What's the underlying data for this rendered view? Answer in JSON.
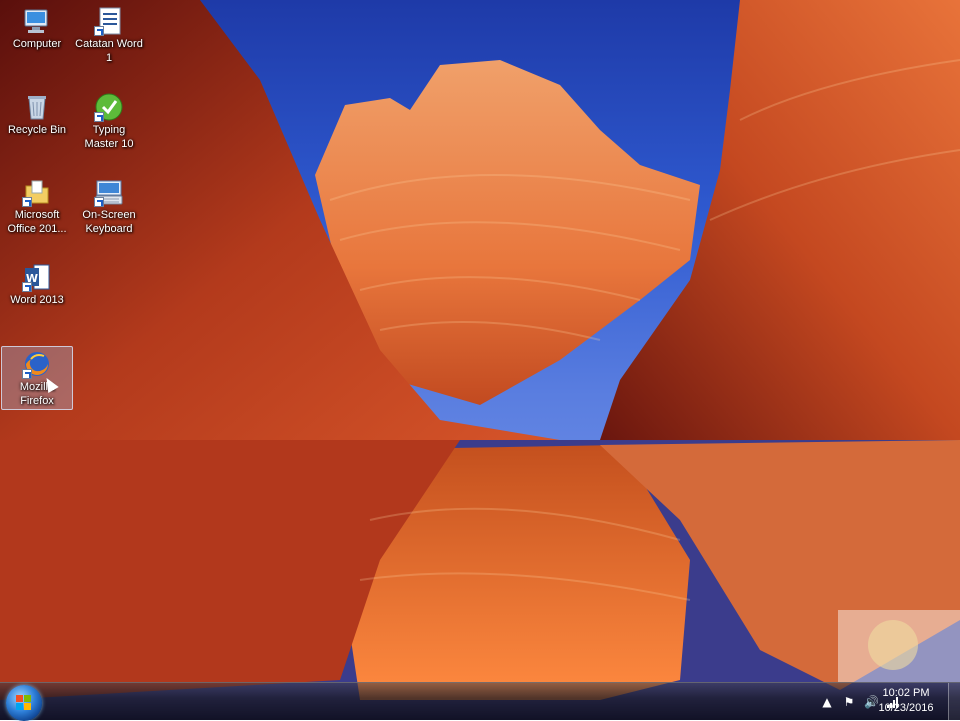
{
  "desktop": {
    "icons": [
      {
        "label": "Computer",
        "icon": "computer-icon"
      },
      {
        "label": "Catatan Word\n1",
        "icon": "word-document-icon"
      },
      {
        "label": "Recycle Bin",
        "icon": "recycle-bin-icon"
      },
      {
        "label": "Typing\nMaster 10",
        "icon": "typing-master-icon"
      },
      {
        "label": "Microsoft\nOffice 201...",
        "icon": "folder-icon"
      },
      {
        "label": "On-Screen\nKeyboard",
        "icon": "keyboard-icon"
      },
      {
        "label": "Word 2013",
        "icon": "word-2013-icon"
      },
      {
        "label": "Mozilla\nFirefox",
        "icon": "firefox-icon",
        "selected": true
      }
    ]
  },
  "taskbar": {
    "start_icon": "windows-start-icon",
    "tray": [
      {
        "icon": "show-hidden-icons-arrow"
      },
      {
        "icon": "action-center-flag-icon"
      },
      {
        "icon": "volume-icon"
      },
      {
        "icon": "network-signal-icon"
      }
    ],
    "clock": {
      "time": "10:02 PM",
      "date": "10/23/2016"
    }
  }
}
